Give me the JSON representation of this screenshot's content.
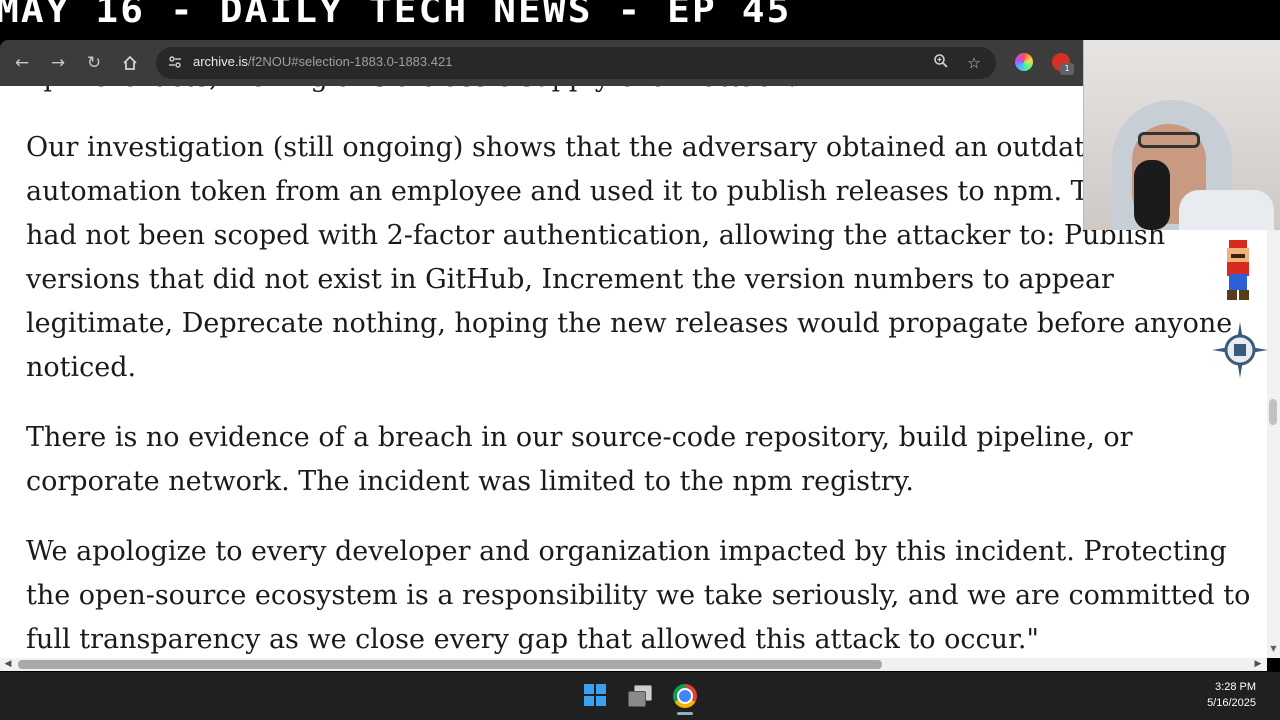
{
  "banner": {
    "title": "MAY 16 - DAILY TECH NEWS - EP 45"
  },
  "browser": {
    "url_host": "archive.is",
    "url_path": "/f2NOU#selection-1883.0-1883.421",
    "extension_badge": "1",
    "icons": [
      "back-icon",
      "forward-icon",
      "reload-icon",
      "home-icon",
      "site-info-icon",
      "zoom-icon",
      "bookmark-star-icon",
      "extension-icon",
      "profile-icon"
    ]
  },
  "article": {
    "top_line": "npm artifacts, making this a classic supply-chain attack.",
    "paragraphs": [
      "Our investigation (still ongoing) shows that the adversary obtained an outdated automation token from an employee and used it to publish releases to npm. The token had not been scoped with 2-factor authentication, allowing the attacker to: Publish versions that did not exist in GitHub, Increment the version numbers to appear legitimate, Deprecate nothing, hoping the new releases would propagate before anyone noticed.",
      "There is no evidence of a breach in our source-code repository, build pipeline, or corporate network. The incident was limited to the npm registry.",
      "We apologize to every developer and organization impacted by this incident. Protecting the open-source ecosystem is a responsibility we take seriously, and we are committed to full transparency as we close every gap that allowed this attack to occur.\""
    ]
  },
  "taskbar": {
    "time": "3:28 PM",
    "date": "5/16/2025"
  },
  "colors": {
    "toolbar": "#3c3c3c",
    "omnibox": "#282828",
    "taskbar": "#202020",
    "windows_blue": "#3aa0f0"
  }
}
